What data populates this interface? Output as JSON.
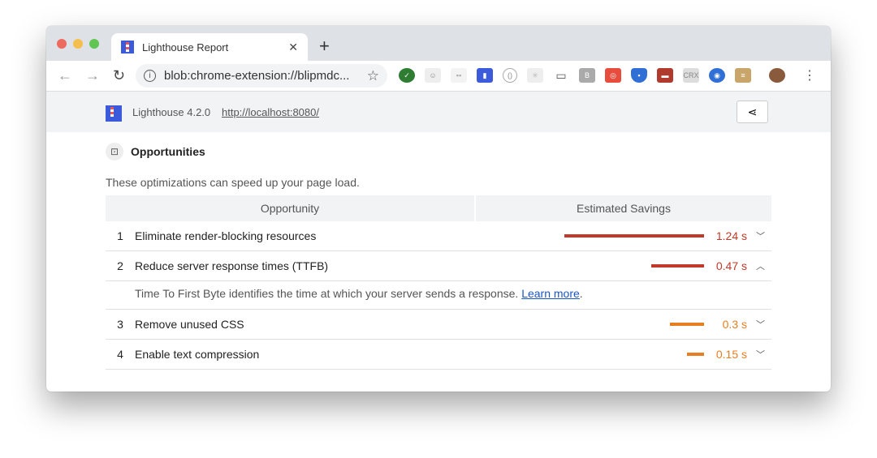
{
  "browser": {
    "tab_title": "Lighthouse Report",
    "url": "blob:chrome-extension://blipmdc...",
    "extensions": [
      "adblock-check-icon",
      "ghost-icon",
      "extension-icon",
      "lighthouse-icon",
      "code-icon",
      "react-icon",
      "laptop-icon",
      "b-icon",
      "target-icon",
      "shield-icon",
      "bookmark-icon",
      "crx-icon",
      "vpn-icon",
      "note-icon"
    ]
  },
  "header": {
    "version": "Lighthouse 4.2.0",
    "url": "http://localhost:8080/"
  },
  "section": {
    "title": "Opportunities",
    "description": "These optimizations can speed up your page load.",
    "col_opportunity": "Opportunity",
    "col_savings": "Estimated Savings"
  },
  "rows": [
    {
      "num": "1",
      "label": "Eliminate render-blocking resources",
      "value": "1.24 s",
      "savings_s": 1.24,
      "color": "#c0392b",
      "expanded": false
    },
    {
      "num": "2",
      "label": "Reduce server response times (TTFB)",
      "value": "0.47 s",
      "savings_s": 0.47,
      "color": "#c0392b",
      "expanded": true,
      "details": "Time To First Byte identifies the time at which your server sends a response. ",
      "link": "Learn more"
    },
    {
      "num": "3",
      "label": "Remove unused CSS",
      "value": "0.3 s",
      "savings_s": 0.3,
      "color": "#e67e22",
      "expanded": false
    },
    {
      "num": "4",
      "label": "Enable text compression",
      "value": "0.15 s",
      "savings_s": 0.15,
      "color": "#e67e22",
      "expanded": false
    }
  ]
}
